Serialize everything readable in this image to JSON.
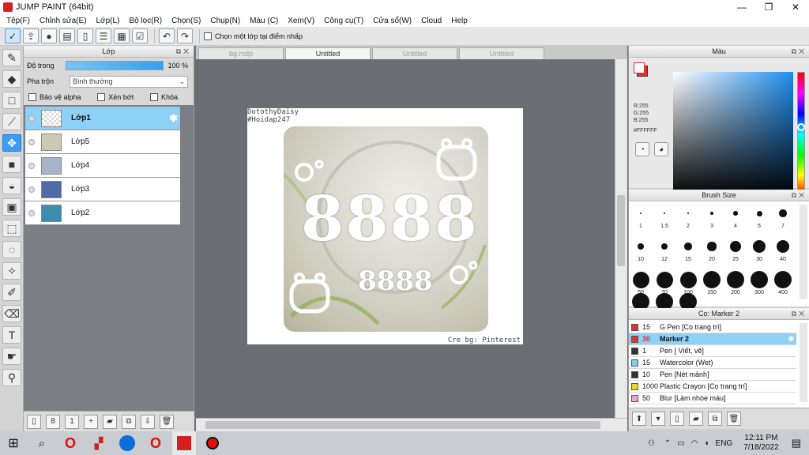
{
  "window": {
    "title": "JUMP PAINT (64bit)",
    "controls": [
      "—",
      "❐",
      "✕"
    ]
  },
  "menu": [
    "Tệp(F)",
    "Chỉnh sửa(E)",
    "Lớp(L)",
    "Bộ lọc(R)",
    "Chọn(S)",
    "Chụp(N)",
    "Màu (C)",
    "Xem(V)",
    "Công cụ(T)",
    "Cửa sổ(W)",
    "Cloud",
    "Help"
  ],
  "toolbar": {
    "checkbox_label": "Chọn một lớp tại điểm nhấp",
    "undo": "↶",
    "redo": "↷"
  },
  "layer_panel": {
    "title": "Lớp",
    "opacity_label": "Độ trong",
    "opacity_value": "100 %",
    "opacity_fraction": 1.0,
    "blend_label": "Pha trộn",
    "blend_value": "Bình thường",
    "options": [
      "Bảo vệ alpha",
      "Xén bớt",
      "Khóa"
    ],
    "layers": [
      "Lớp1",
      "Lớp5",
      "Lớp4",
      "Lớp3",
      "Lớp2"
    ],
    "selected_layer": "Lớp1"
  },
  "tabs": [
    "bg.mdp",
    "Untitled",
    "Untitled",
    "Untitled"
  ],
  "active_tab": 1,
  "canvas": {
    "watermark_line1": "DotothyDaisy",
    "watermark_line2": "#Hoidap247",
    "big_number": "8888",
    "small_number": "8888",
    "credit": "Cre bg: Pinterest"
  },
  "color_panel": {
    "title": "Màu",
    "r": "R:255",
    "g": "G:255",
    "b": "B:255",
    "hex": "#FFFFFF",
    "foreground": "#ffffff",
    "background": "#e03030"
  },
  "brush_size_panel": {
    "title": "Brush Size",
    "sizes": [
      "1",
      "1.5",
      "2",
      "3",
      "4",
      "5",
      "7",
      "10",
      "12",
      "15",
      "20",
      "25",
      "30",
      "40",
      "50",
      "70",
      "100",
      "150",
      "200",
      "300",
      "400"
    ]
  },
  "brush_panel": {
    "title": "Cọ: Marker 2",
    "brushes": [
      {
        "size": "15",
        "name": "G Pen [Cọ trang trí]",
        "color": "#e03030"
      },
      {
        "size": "30",
        "name": "Marker 2",
        "color": "#e03030"
      },
      {
        "size": "1",
        "name": "Pen [ Viết, vẽ]",
        "color": "#333333"
      },
      {
        "size": "15",
        "name": "Watercolor (Wet)",
        "color": "#7fd0f0"
      },
      {
        "size": "10",
        "name": "Pen [Nét mảnh]",
        "color": "#333333"
      },
      {
        "size": "1000",
        "name": "Plastic Crayon [Cọ trang trí]",
        "color": "#e8d820"
      },
      {
        "size": "50",
        "name": "Blur [Làm nhòe màu]",
        "color": "#f0a0d8"
      }
    ],
    "selected": 1
  },
  "taskbar": {
    "lang": "ENG",
    "time": "12:11 PM",
    "date": "7/18/2022"
  }
}
